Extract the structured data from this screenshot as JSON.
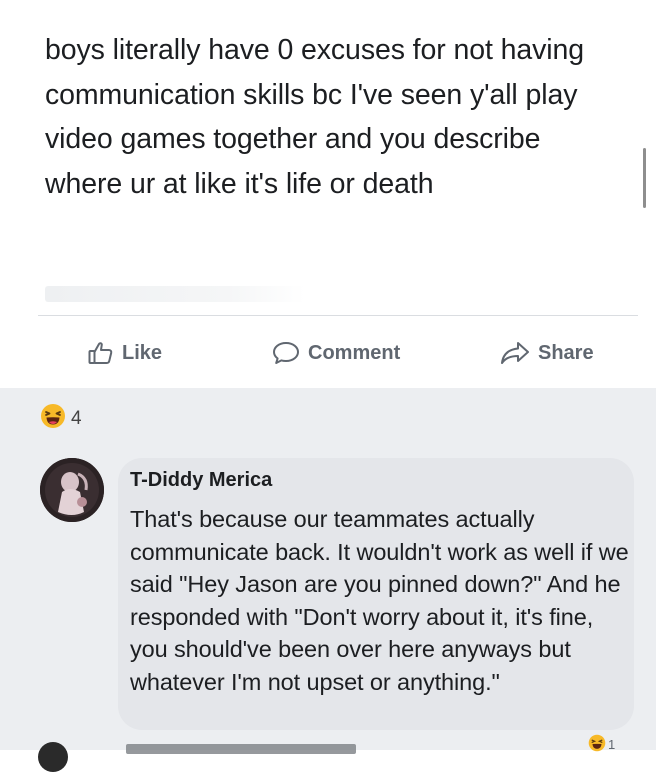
{
  "post": {
    "text": "boys literally have 0 excuses for not having communication skills bc I've seen y'all play video games together and you describe where ur at like it's life or death"
  },
  "actions": {
    "like_label": "Like",
    "comment_label": "Comment",
    "share_label": "Share"
  },
  "reactions": {
    "icon": "haha-emoji-icon",
    "count": "4"
  },
  "comment": {
    "author": "T-Diddy Merica",
    "text": "That's because our teammates actually communicate back. It wouldn't work as well if we said \"Hey Jason are you pinned down?\" And he responded with \"Don't worry about it, it's fine, you should've been over here anyways but whatever I'm not upset or anything.\"",
    "reaction_count": "1"
  },
  "colors": {
    "text": "#1c1e21",
    "muted": "#606770",
    "comment_bubble": "#e4e6ea",
    "background_grey": "#eceef1"
  }
}
